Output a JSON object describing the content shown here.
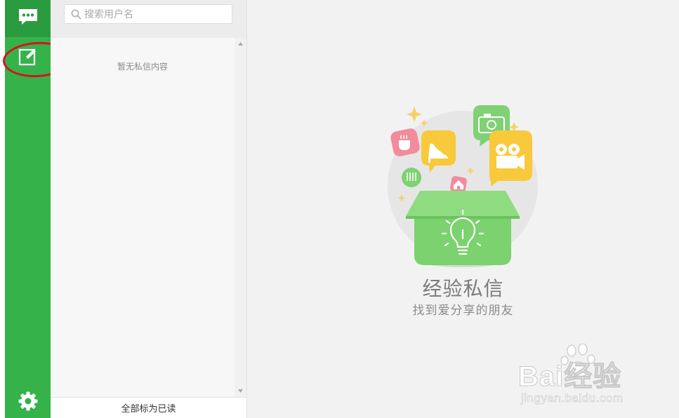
{
  "sidebar": {
    "items": [
      {
        "name": "messages",
        "icon": "chat-bubble-icon"
      },
      {
        "name": "compose",
        "icon": "edit-icon"
      },
      {
        "name": "settings",
        "icon": "gear-icon"
      }
    ],
    "accent": "#36b24b",
    "active_bg": "#2a9c3f"
  },
  "search": {
    "placeholder": "搜索用户名",
    "value": "",
    "icon": "search-icon"
  },
  "list": {
    "empty_text": "暂无私信内容"
  },
  "footer": {
    "mark_all_read_label": "全部标为已读"
  },
  "main": {
    "empty_title": "经验私信",
    "empty_subtitle": "找到爱分享的朋友"
  },
  "watermark": {
    "logo": "Bai经验",
    "logo_du": "du",
    "logo_suffix": "经验",
    "url": "jingyan.baidu.com"
  },
  "annotation": {
    "color": "#d6141e"
  }
}
